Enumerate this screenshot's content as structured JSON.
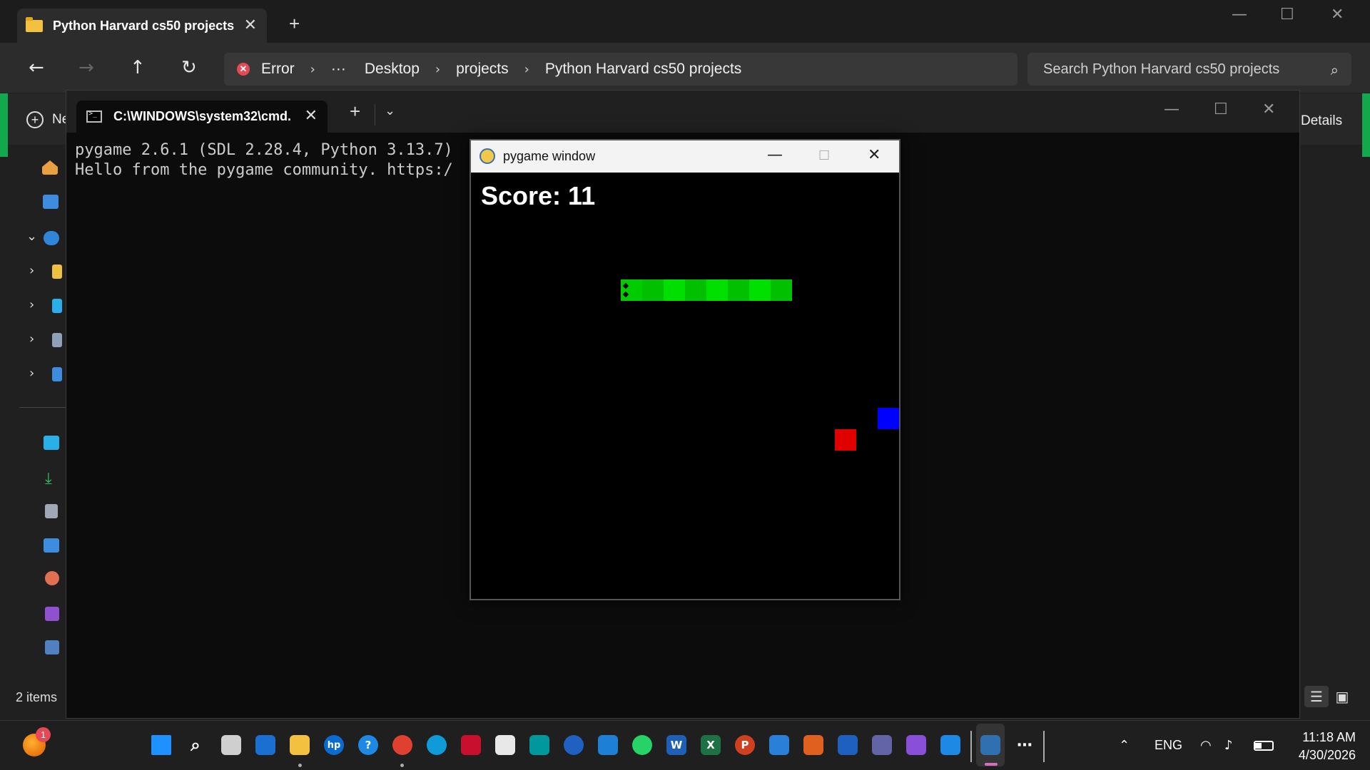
{
  "explorer": {
    "tab_title": "Python Harvard cs50 projects",
    "breadcrumbs": [
      "Error",
      "Desktop",
      "projects",
      "Python Harvard cs50 projects"
    ],
    "overflow": "···",
    "search_placeholder": "Search Python Harvard cs50 projects",
    "new_label": "Ne",
    "details_label": "Details",
    "status": "2 items"
  },
  "terminal": {
    "tab_title": "C:\\WINDOWS\\system32\\cmd.",
    "output_line_1": "pygame 2.6.1 (SDL 2.28.4, Python 3.13.7)",
    "output_line_2": "Hello from the pygame community. https:/"
  },
  "pygame_window": {
    "title": "pygame window",
    "score_text": "Score: 11",
    "game": {
      "grid_cell": 30,
      "snake": [
        [
          7,
          5
        ],
        [
          8,
          5
        ],
        [
          9,
          5
        ],
        [
          10,
          5
        ],
        [
          11,
          5
        ],
        [
          12,
          5
        ],
        [
          13,
          5
        ],
        [
          14,
          5
        ]
      ],
      "snake_color_a": "#00e000",
      "snake_color_b": "#00c000",
      "food": [
        {
          "cell": [
            17,
            12
          ],
          "color": "#e00000"
        },
        {
          "cell": [
            19,
            11
          ],
          "color": "#0000ff"
        }
      ]
    }
  },
  "taskbar": {
    "notification_count": "1",
    "language": "ENG",
    "time": "11:18 AM",
    "date": "4/30/2026"
  },
  "colors": {
    "accent_green": "#12a84b",
    "error_red": "#e74856"
  }
}
